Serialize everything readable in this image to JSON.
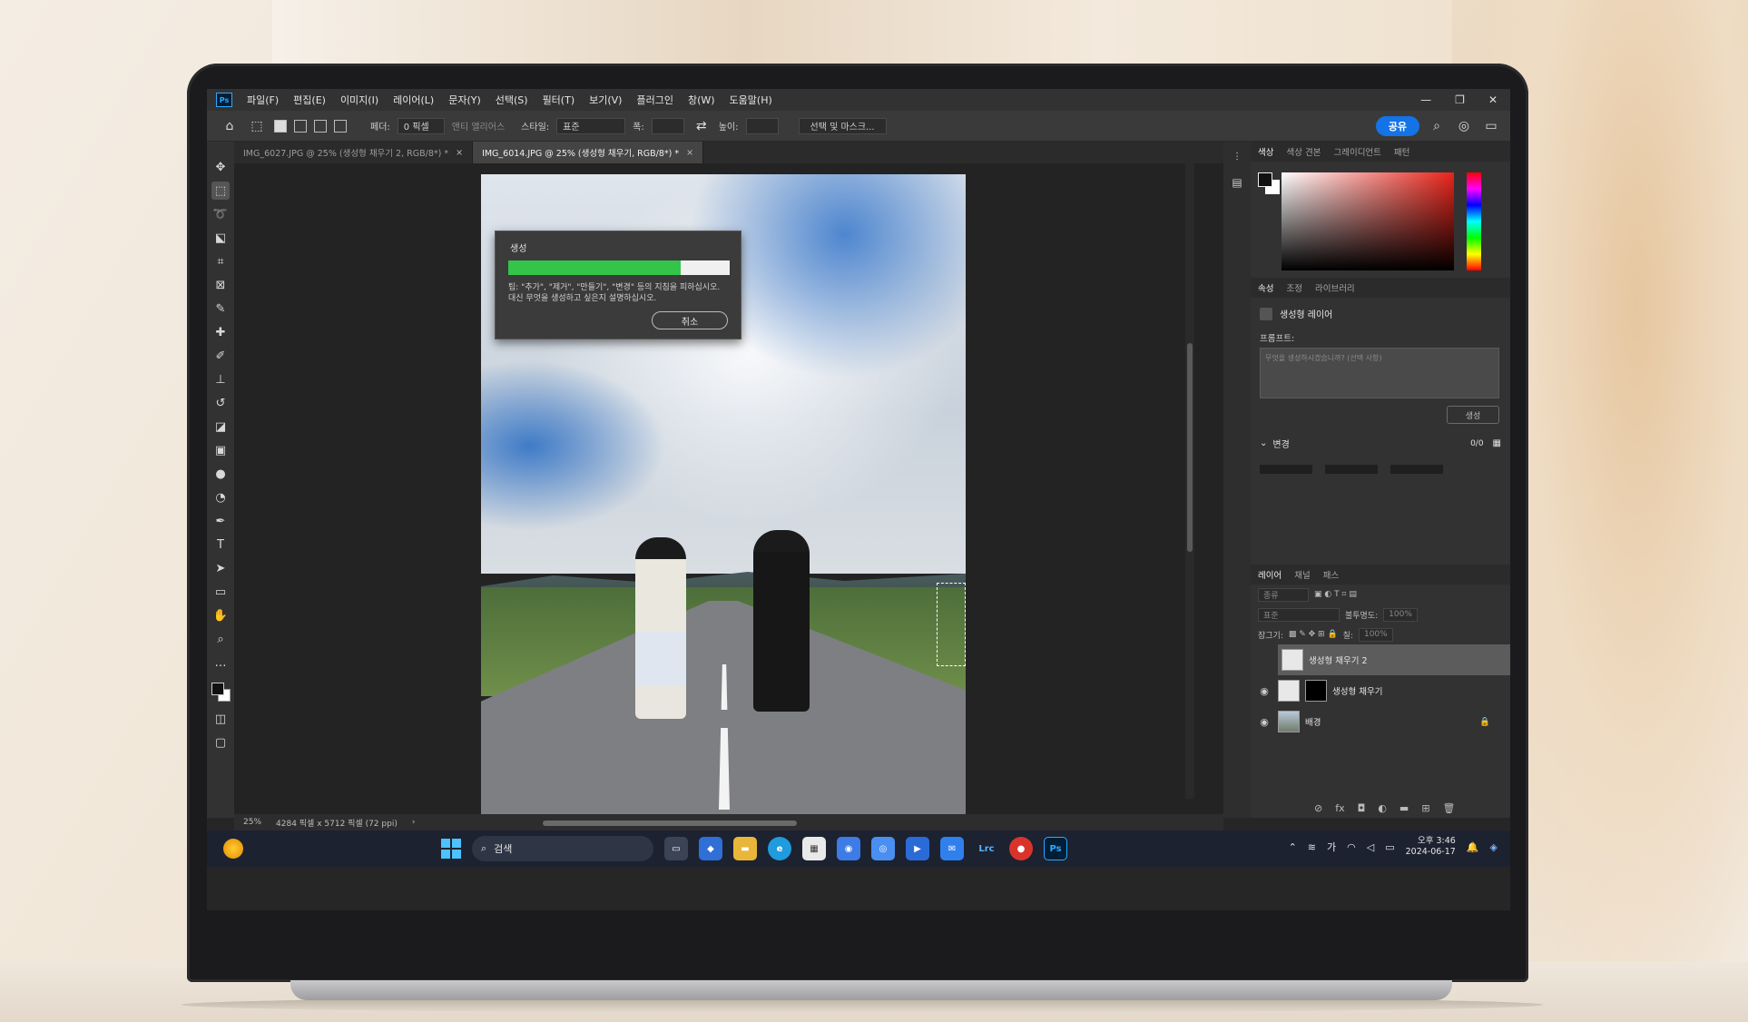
{
  "menu": {
    "app_logo": "Ps",
    "items": [
      "파일(F)",
      "편집(E)",
      "이미지(I)",
      "레이어(L)",
      "문자(Y)",
      "선택(S)",
      "필터(T)",
      "보기(V)",
      "플러그인",
      "창(W)",
      "도움말(H)"
    ],
    "window_controls": [
      "—",
      "❐",
      "✕"
    ]
  },
  "options": {
    "feather_label": "페더:",
    "feather_value": "0 픽셀",
    "antialias": "앤티 앨리어스",
    "style_label": "스타일:",
    "style_value": "표준",
    "width_label": "폭:",
    "height_label": "높이:",
    "select_mask": "선택 및 마스크...",
    "share_label": "공유"
  },
  "tabs": [
    {
      "label": "IMG_6027.JPG @ 25% (생성형 채우기 2, RGB/8*) *",
      "close": "×"
    },
    {
      "label": "IMG_6014.JPG @ 25% (생성형 채우기, RGB/8*) *",
      "close": "×"
    }
  ],
  "dialog": {
    "title": "생성",
    "progress": 0.78,
    "tip": "팁: \"추가\", \"제거\", \"만들기\", \"변경\" 등의 지침을 피하십시오. 대신 무엇을 생성하고 싶은지 설명하십시오.",
    "cancel_label": "취소"
  },
  "status": {
    "zoom": "25%",
    "doc_size": "4284 픽셀 x 5712 픽셀 (72 ppi)"
  },
  "color_panel": {
    "tabs": [
      "색상",
      "색상 견본",
      "그레이디언트",
      "패턴"
    ]
  },
  "properties_panel": {
    "tabs": [
      "속성",
      "조정",
      "라이브러리"
    ],
    "layer_type": "생성형 레이어",
    "prompt_label": "프롬프트:",
    "prompt_placeholder": "무엇을 생성하시겠습니까? (선택 사항)",
    "generate_label": "생성",
    "variations_label": "변경",
    "variations_count": "0/0"
  },
  "layers_panel": {
    "tabs": [
      "레이어",
      "채널",
      "패스"
    ],
    "search_label": "종류",
    "blend_mode": "표준",
    "opacity_label": "불투명도:",
    "opacity_value": "100%",
    "lock_label": "잠그기:",
    "fill_label": "칠:",
    "fill_value": "100%",
    "layers": [
      {
        "name": "생성형 채우기 2",
        "active": true
      },
      {
        "name": "생성형 채우기",
        "active": false
      },
      {
        "name": "배경",
        "active": false
      }
    ]
  },
  "taskbar": {
    "search_label": "검색",
    "tray_lang": "가",
    "time": "오후 3:46",
    "date": "2024-06-17"
  }
}
